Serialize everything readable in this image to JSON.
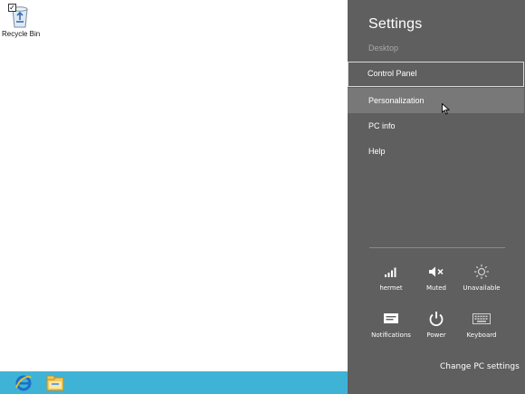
{
  "desktop": {
    "recycle_bin_label": "Recycle Bin"
  },
  "taskbar": {
    "ie_icon": "internet-explorer-icon",
    "explorer_icon": "file-explorer-icon",
    "color": "#3fb3d6"
  },
  "charm": {
    "title": "Settings",
    "context": "Desktop",
    "items": [
      {
        "label": "Control Panel"
      },
      {
        "label": "Personalization"
      },
      {
        "label": "PC info"
      },
      {
        "label": "Help"
      }
    ],
    "tiles": [
      {
        "label": "hermet",
        "icon": "network-signal-icon"
      },
      {
        "label": "Muted",
        "icon": "volume-muted-icon"
      },
      {
        "label": "Unavailable",
        "icon": "brightness-icon"
      },
      {
        "label": "Notifications",
        "icon": "notifications-icon"
      },
      {
        "label": "Power",
        "icon": "power-icon"
      },
      {
        "label": "Keyboard",
        "icon": "keyboard-icon"
      }
    ],
    "change_settings": "Change PC settings",
    "background": "#5f5f5f"
  }
}
